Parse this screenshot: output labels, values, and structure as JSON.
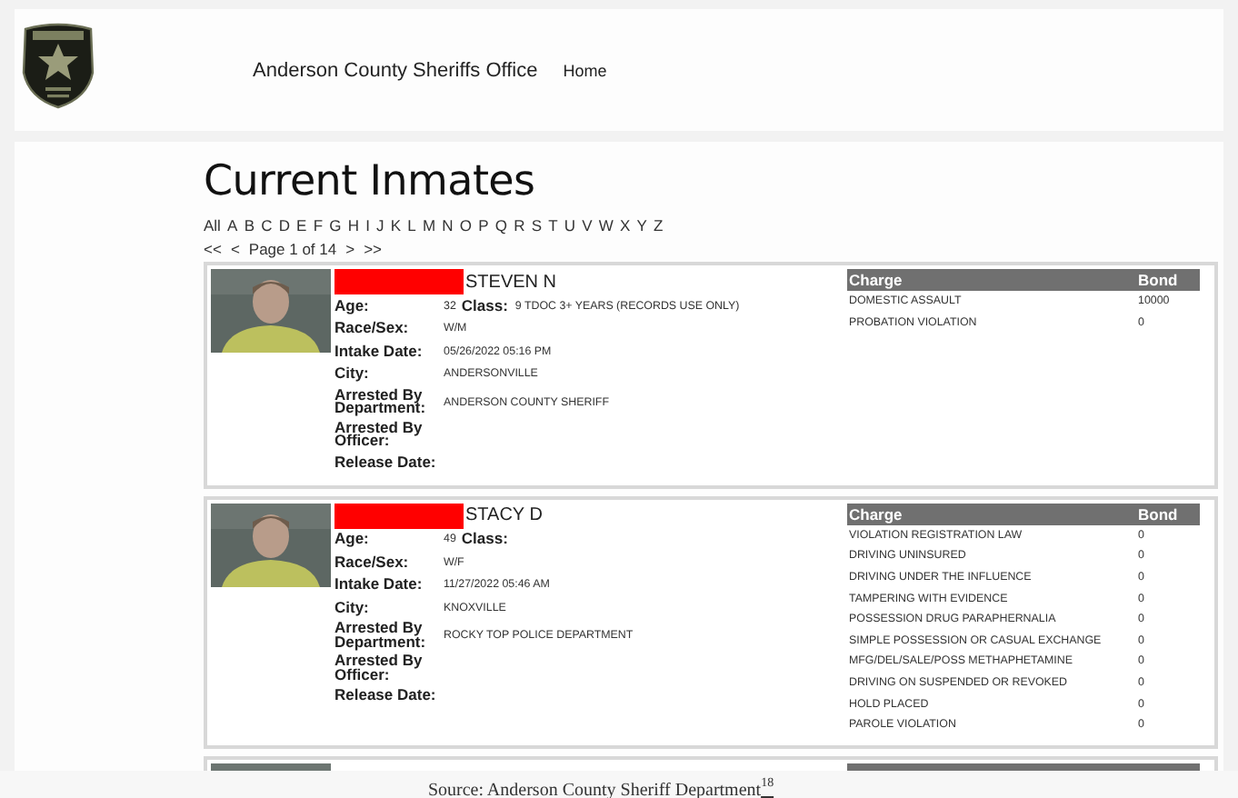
{
  "header": {
    "site_title": "Anderson County Sheriffs Office",
    "nav": [
      "Home"
    ]
  },
  "title": "Current Inmates",
  "letters": [
    "All",
    "A",
    "B",
    "C",
    "D",
    "E",
    "F",
    "G",
    "H",
    "I",
    "J",
    "K",
    "L",
    "M",
    "N",
    "O",
    "P",
    "Q",
    "R",
    "S",
    "T",
    "U",
    "V",
    "W",
    "X",
    "Y",
    "Z"
  ],
  "pager": [
    "<<",
    "<",
    "Page 1 of 14",
    ">",
    ">>"
  ],
  "inmates": [
    {
      "kind": "full",
      "name": "STEVEN N",
      "class": {
        "label": "Class:",
        "value": "9 TDOC 3+ YEARS (RECORDS USE ONLY)"
      },
      "fields": [
        {
          "label": "Age:",
          "value": "32"
        },
        {
          "label": "Race/Sex:",
          "value": "W/M"
        },
        {
          "label": "Intake Date:",
          "value": "05/26/2022 05:16 PM"
        },
        {
          "label": "City:",
          "value": "ANDERSONVILLE"
        },
        {
          "label": "Arrested By Department:",
          "value": "ANDERSON COUNTY SHERIFF"
        },
        {
          "label": "Arrested By Officer:"
        },
        {
          "label": "Release Date:"
        }
      ],
      "charge_header": [
        "Charge",
        "Bond"
      ],
      "charges": [
        {
          "charge": "DOMESTIC ASSAULT",
          "bond": "10000"
        },
        {
          "charge": "PROBATION VIOLATION",
          "bond": "0"
        }
      ]
    },
    {
      "kind": "full",
      "name": "STACY D",
      "class": {
        "label": "Class:"
      },
      "fields": [
        {
          "label": "Age:",
          "value": "49"
        },
        {
          "label": "Race/Sex:",
          "value": "W/F"
        },
        {
          "label": "Intake Date:",
          "value": "11/27/2022 05:46 AM"
        },
        {
          "label": "City:",
          "value": "KNOXVILLE"
        },
        {
          "label": "Arrested By Department:",
          "value": "ROCKY TOP POLICE DEPARTMENT"
        },
        {
          "label": "Arrested By Officer:"
        },
        {
          "label": "Release Date:"
        }
      ],
      "charge_header": [
        "Charge",
        "Bond"
      ],
      "charges": [
        {
          "charge": "VIOLATION REGISTRATION LAW",
          "bond": "0"
        },
        {
          "charge": "DRIVING UNINSURED",
          "bond": "0"
        },
        {
          "charge": "DRIVING UNDER THE INFLUENCE",
          "bond": "0"
        },
        {
          "charge": "TAMPERING WITH EVIDENCE",
          "bond": "0"
        },
        {
          "charge": "POSSESSION DRUG PARAPHERNALIA",
          "bond": "0"
        },
        {
          "charge": "SIMPLE POSSESSION OR CASUAL EXCHANGE",
          "bond": "0"
        },
        {
          "charge": "MFG/DEL/SALE/POSS METHAPHETAMINE",
          "bond": "0"
        },
        {
          "charge": "DRIVING ON SUSPENDED OR REVOKED",
          "bond": "0"
        },
        {
          "charge": "HOLD PLACED",
          "bond": "0"
        },
        {
          "charge": "PAROLE VIOLATION",
          "bond": "0"
        }
      ]
    },
    {
      "kind": "cut"
    }
  ],
  "caption": {
    "text": "Source: Anderson County Sheriff Department",
    "note": "18"
  }
}
